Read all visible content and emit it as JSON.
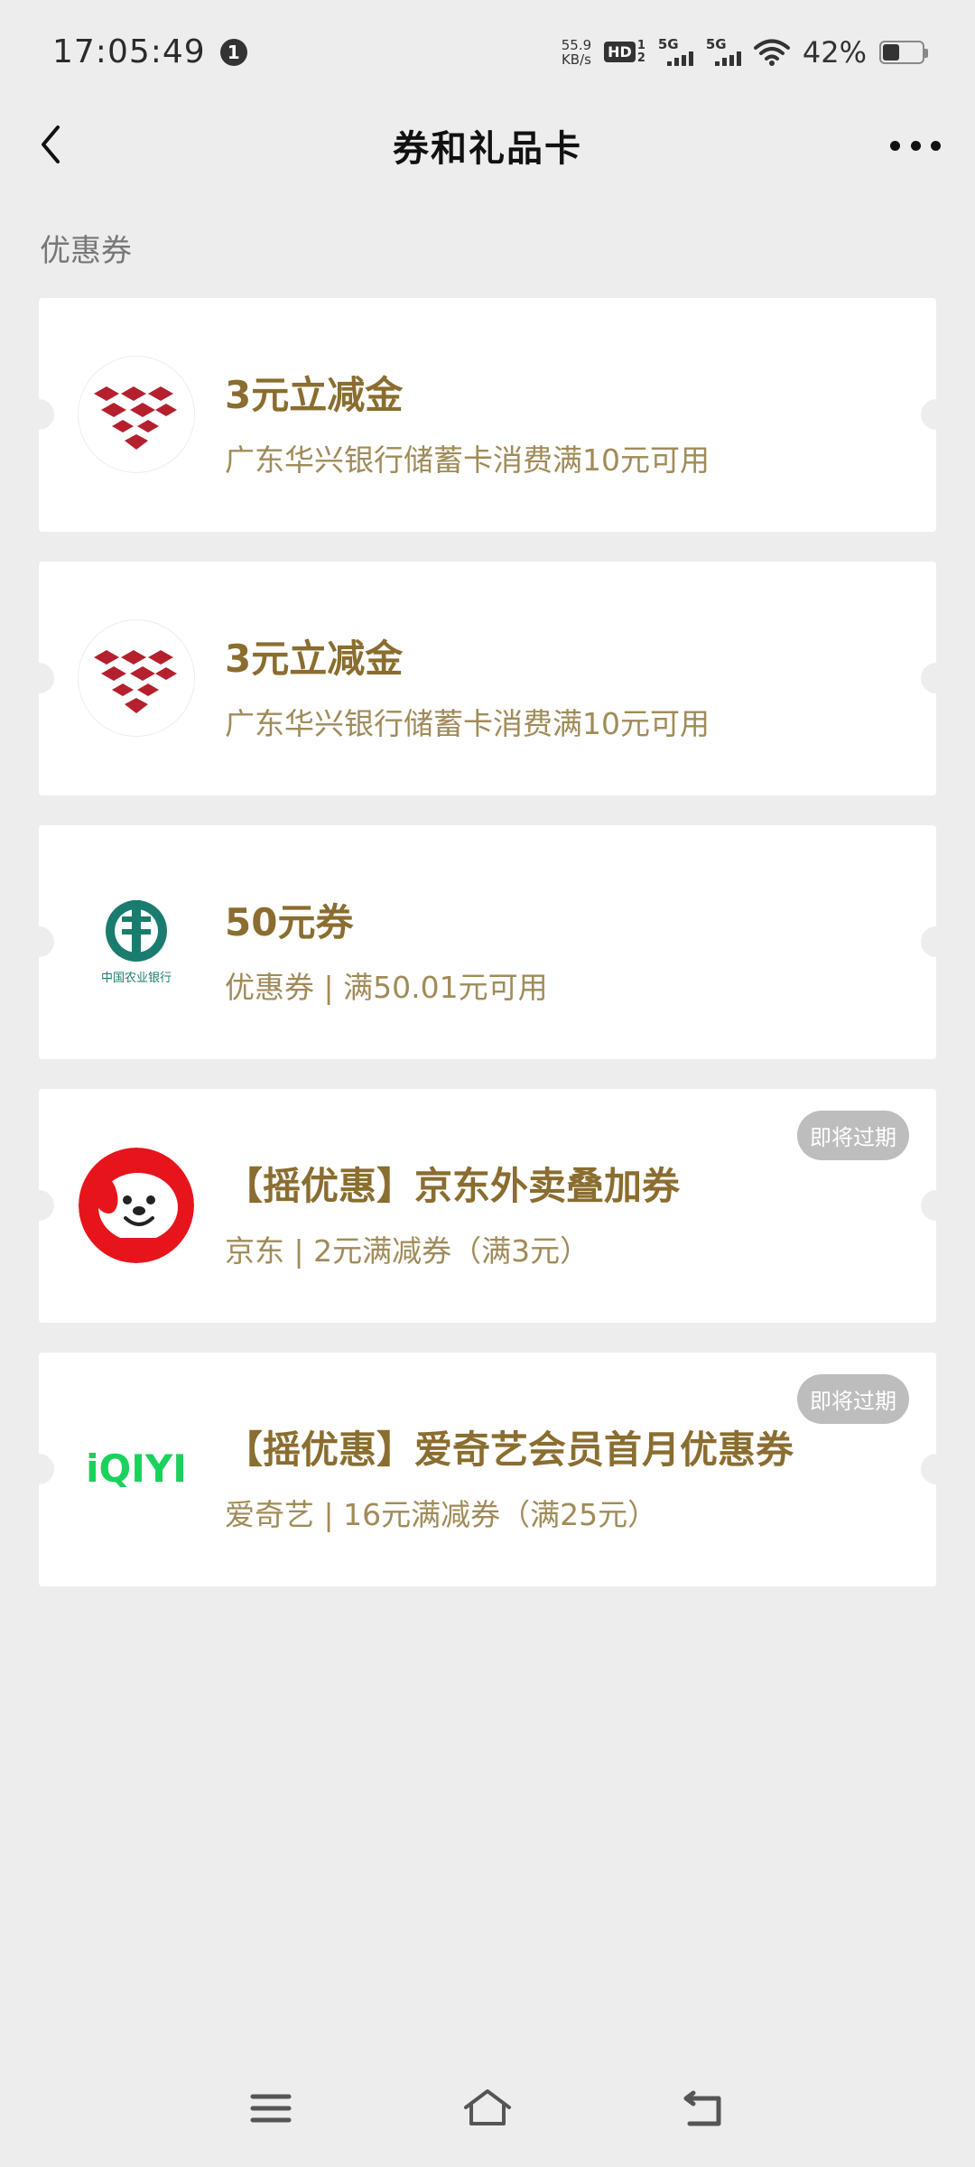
{
  "status_bar": {
    "time": "17:05:49",
    "notification_count": "1",
    "net_speed_value": "55.9",
    "net_speed_unit": "KB/s",
    "hd_label": "HD",
    "hd_sim_top": "1",
    "hd_sim_bottom": "2",
    "signal1_label": "5G",
    "signal2_label": "5G",
    "battery_percent": "42%",
    "battery_level": 0.42
  },
  "header": {
    "title": "券和礼品卡",
    "back_icon": "chevron-left-icon",
    "more_icon": "more-dots-icon"
  },
  "section": {
    "title": "优惠券"
  },
  "coupons": [
    {
      "title": "3元立减金",
      "subtitle": "广东华兴银行储蓄卡消费满10元可用",
      "logo": "ghb-bank-logo",
      "badge": ""
    },
    {
      "title": "3元立减金",
      "subtitle": "广东华兴银行储蓄卡消费满10元可用",
      "logo": "ghb-bank-logo",
      "badge": ""
    },
    {
      "title": "50元券",
      "subtitle": "优惠券 | 满50.01元可用",
      "logo": "abc-bank-logo",
      "logo_text": "中国农业银行",
      "badge": ""
    },
    {
      "title": "【摇优惠】京东外卖叠加券",
      "subtitle": "京东 | 2元满减券（满3元）",
      "logo": "jd-dog-logo",
      "badge": "即将过期"
    },
    {
      "title": "【摇优惠】爱奇艺会员首月优惠券",
      "subtitle": "爱奇艺 | 16元满减券（满25元）",
      "logo": "iqiyi-logo",
      "logo_text": "iQIYI",
      "badge": "即将过期"
    }
  ],
  "colors": {
    "background": "#ededed",
    "coupon_title": "#8a6d2f",
    "coupon_subtitle": "#a08b59",
    "badge_bg": "#bdbdbd",
    "ghb_red": "#b5202e",
    "abc_green": "#1a7c6e",
    "jd_red": "#e8141c",
    "iqiyi_green": "#1ad15c"
  },
  "bottom_nav": {
    "icons": [
      "menu-icon",
      "home-icon",
      "back-icon"
    ]
  }
}
